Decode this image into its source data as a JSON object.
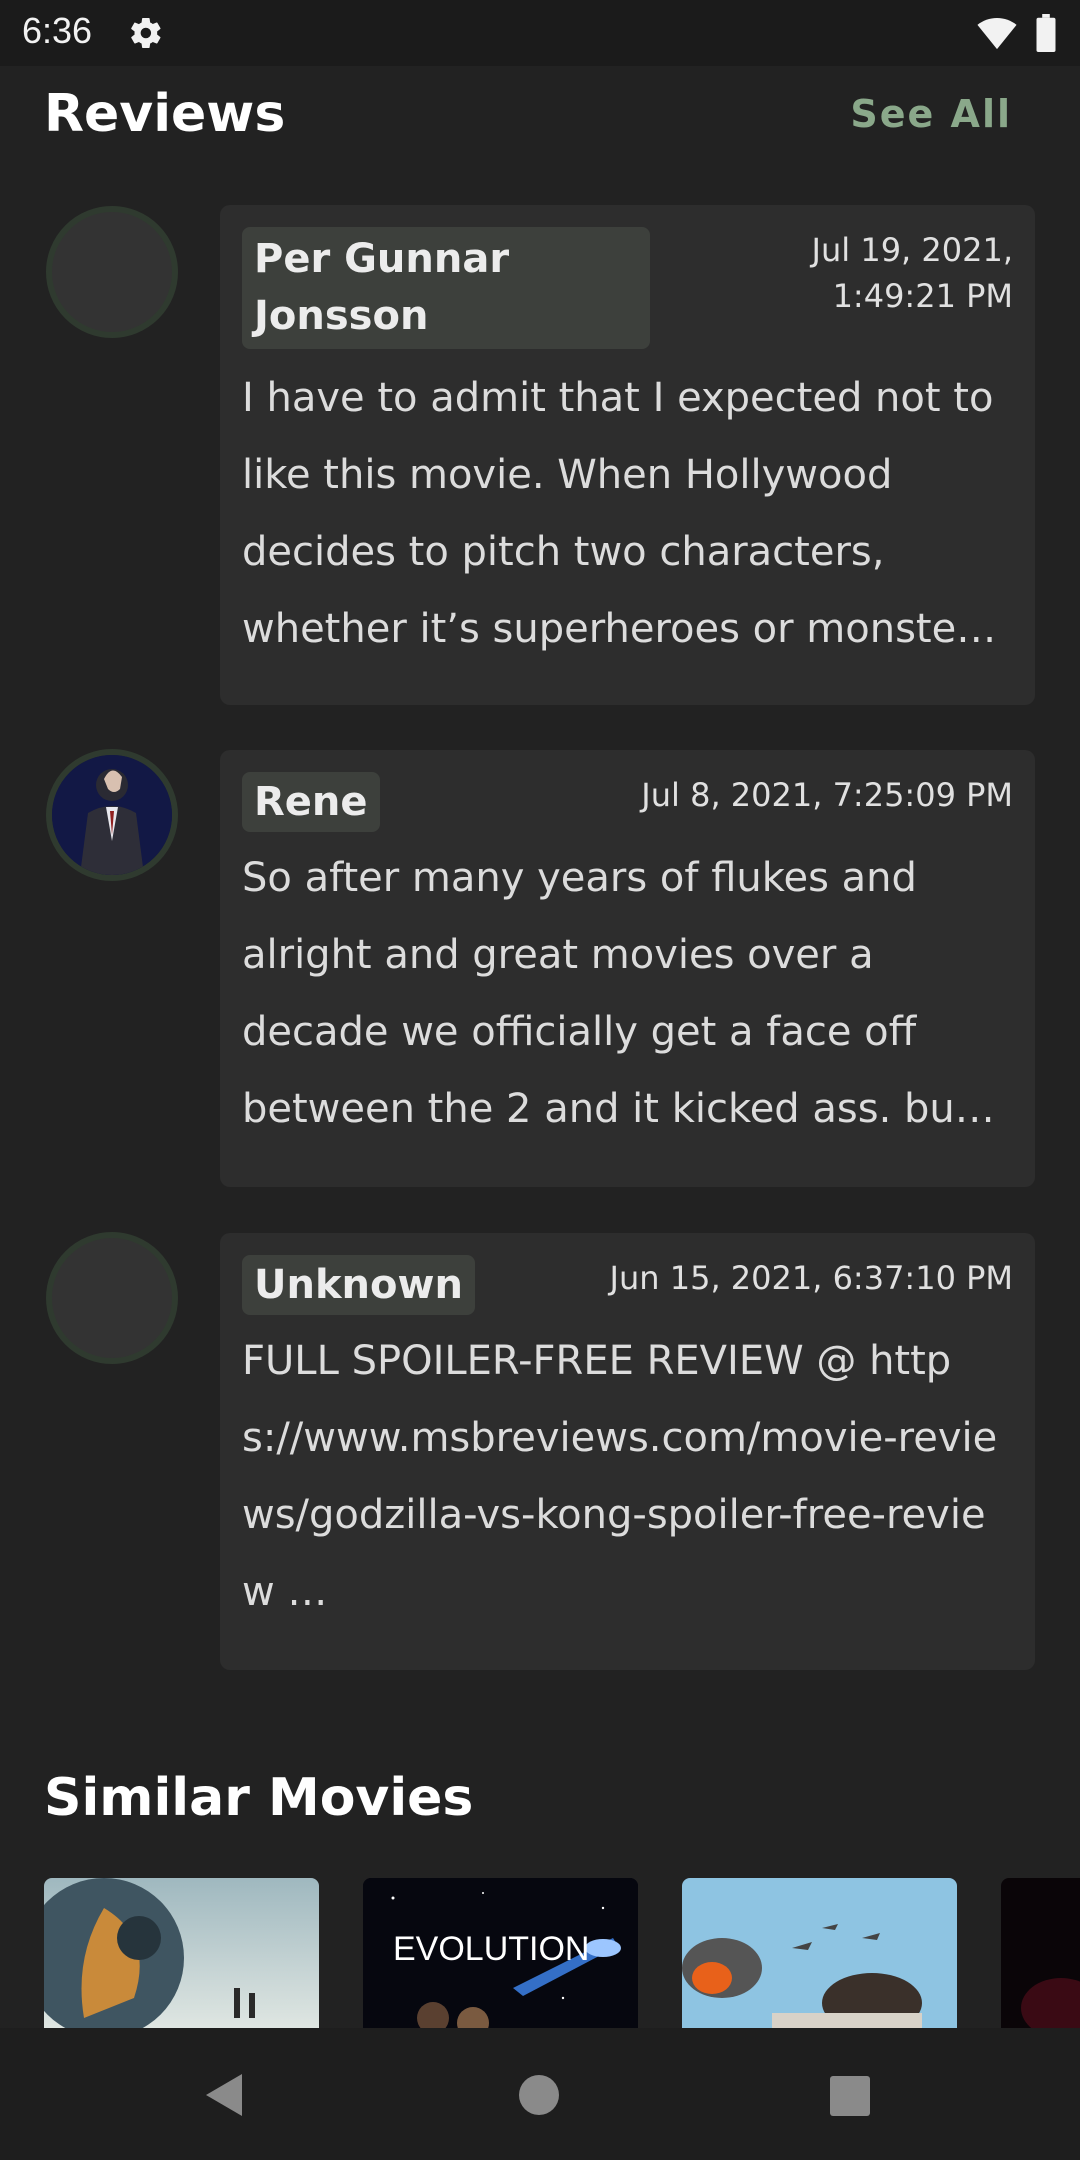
{
  "status": {
    "time": "6:36",
    "icons": [
      "gear-icon",
      "wifi-icon",
      "battery-icon"
    ]
  },
  "reviews": {
    "title": "Reviews",
    "see_all": "See All",
    "items": [
      {
        "author": "Per Gunnar Jonsson",
        "date": "Jul 19, 2021,\n1:49:21 PM",
        "text": "I have to admit that I expected not to like this movie. When Hollywood decides to pitch two characters, whether it’s superheroes or monste…",
        "avatar": "placeholder"
      },
      {
        "author": "Rene",
        "date": "Jul 8, 2021, 7:25:09 PM",
        "text": "So after many years of flukes and alright and great movies over a decade we officially get a face off between the 2 and it kicked ass. bu…",
        "avatar": "photo"
      },
      {
        "author": "Unknown",
        "date": "Jun 15, 2021, 6:37:10 PM",
        "text": "FULL SPOILER-FREE REVIEW @ https://www.msbreviews.com/movie-reviews/godzilla-vs-kong-spoiler-free-review …",
        "avatar": "placeholder"
      }
    ]
  },
  "similar": {
    "title": "Similar Movies",
    "posters": [
      {
        "name": "poster-robot-helmet"
      },
      {
        "name": "poster-evolution",
        "text": "EVOLUTION"
      },
      {
        "name": "poster-kong-battle"
      },
      {
        "name": "poster-partial-dark"
      }
    ]
  },
  "nav": {
    "icons": [
      "back-icon",
      "home-icon",
      "recents-icon"
    ]
  },
  "colors": {
    "background": "#222222",
    "card": "#2d2d2d",
    "accent": "#8aa88a",
    "chip": "#3d403c"
  }
}
